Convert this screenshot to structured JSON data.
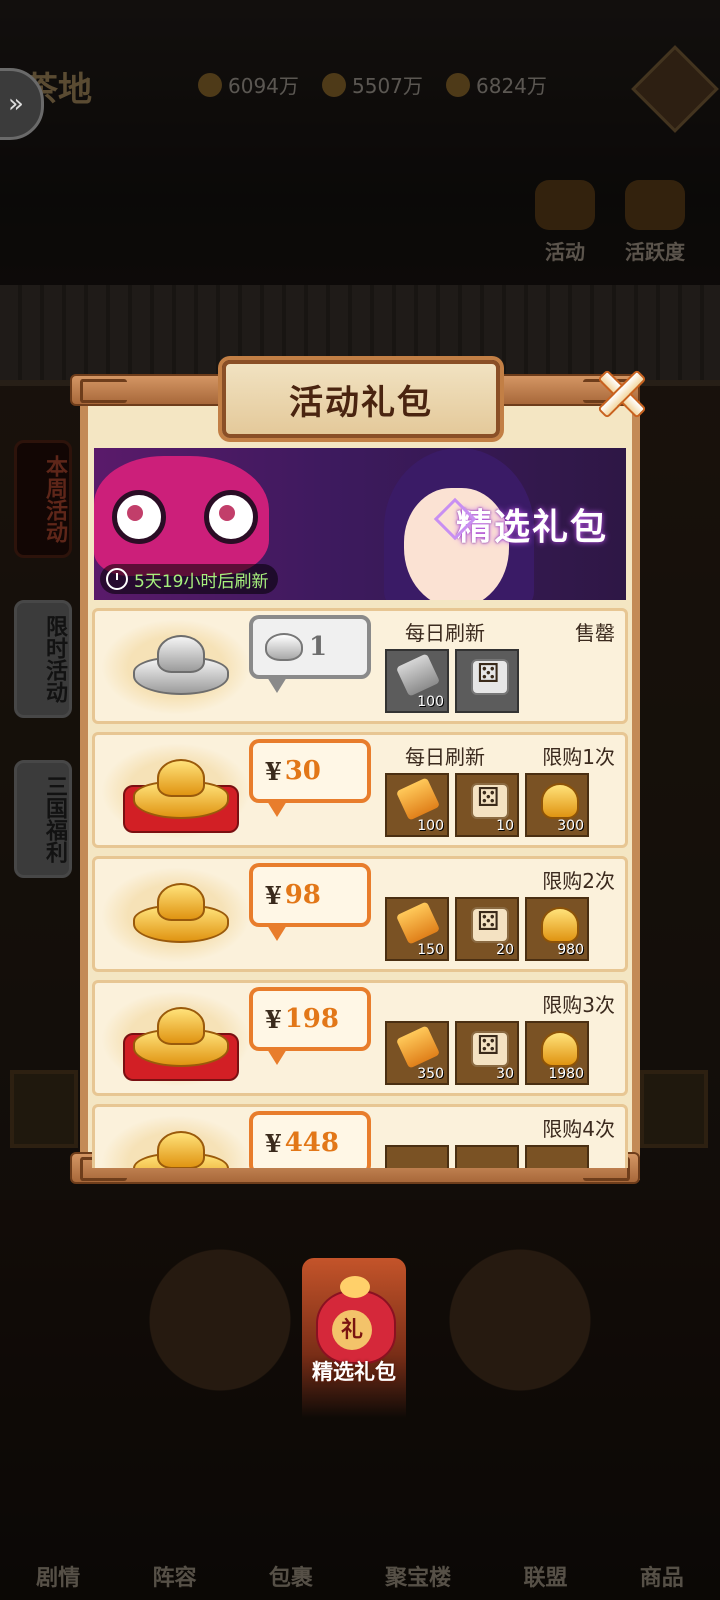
{
  "background": {
    "title": "茶地",
    "resources": [
      "6094万",
      "5507万",
      "6824万"
    ],
    "right_icons": [
      "活动",
      "活跃度"
    ],
    "side_tags": [
      "本周活动",
      "限时活动",
      "三国福利"
    ],
    "bottom_nav": [
      "剧情",
      "阵容",
      "包裹",
      "聚宝楼",
      "联盟",
      "商品"
    ]
  },
  "popup": {
    "title": "活动礼包",
    "banner": {
      "title": "精选礼包",
      "timer": "5天19小时后刷新"
    },
    "packs": [
      {
        "price_type": "silver",
        "currency": "",
        "price": "1",
        "refresh_label": "每日刷新",
        "limit_label": "售罄",
        "items": [
          {
            "icon": "ticket-icon",
            "qty": "100"
          },
          {
            "icon": "dice-icon",
            "qty": ""
          }
        ]
      },
      {
        "price_type": "gold",
        "currency": "¥",
        "price": "30",
        "refresh_label": "每日刷新",
        "limit_label": "限购1次",
        "items": [
          {
            "icon": "ticket-icon",
            "qty": "100"
          },
          {
            "icon": "dice-icon",
            "qty": "10"
          },
          {
            "icon": "gold-ingot-icon",
            "qty": "300"
          }
        ]
      },
      {
        "price_type": "gold",
        "currency": "¥",
        "price": "98",
        "refresh_label": "",
        "limit_label": "限购2次",
        "items": [
          {
            "icon": "ticket-icon",
            "qty": "150"
          },
          {
            "icon": "dice-icon",
            "qty": "20"
          },
          {
            "icon": "gold-ingot-icon",
            "qty": "980"
          }
        ]
      },
      {
        "price_type": "gold",
        "currency": "¥",
        "price": "198",
        "refresh_label": "",
        "limit_label": "限购3次",
        "items": [
          {
            "icon": "ticket-icon",
            "qty": "350"
          },
          {
            "icon": "dice-icon",
            "qty": "30"
          },
          {
            "icon": "gold-ingot-icon",
            "qty": "1980"
          }
        ]
      },
      {
        "price_type": "gold",
        "currency": "¥",
        "price": "448",
        "refresh_label": "",
        "limit_label": "限购4次",
        "items": []
      }
    ]
  },
  "bottom_tab": {
    "label": "精选礼包",
    "bag_char": "礼"
  }
}
